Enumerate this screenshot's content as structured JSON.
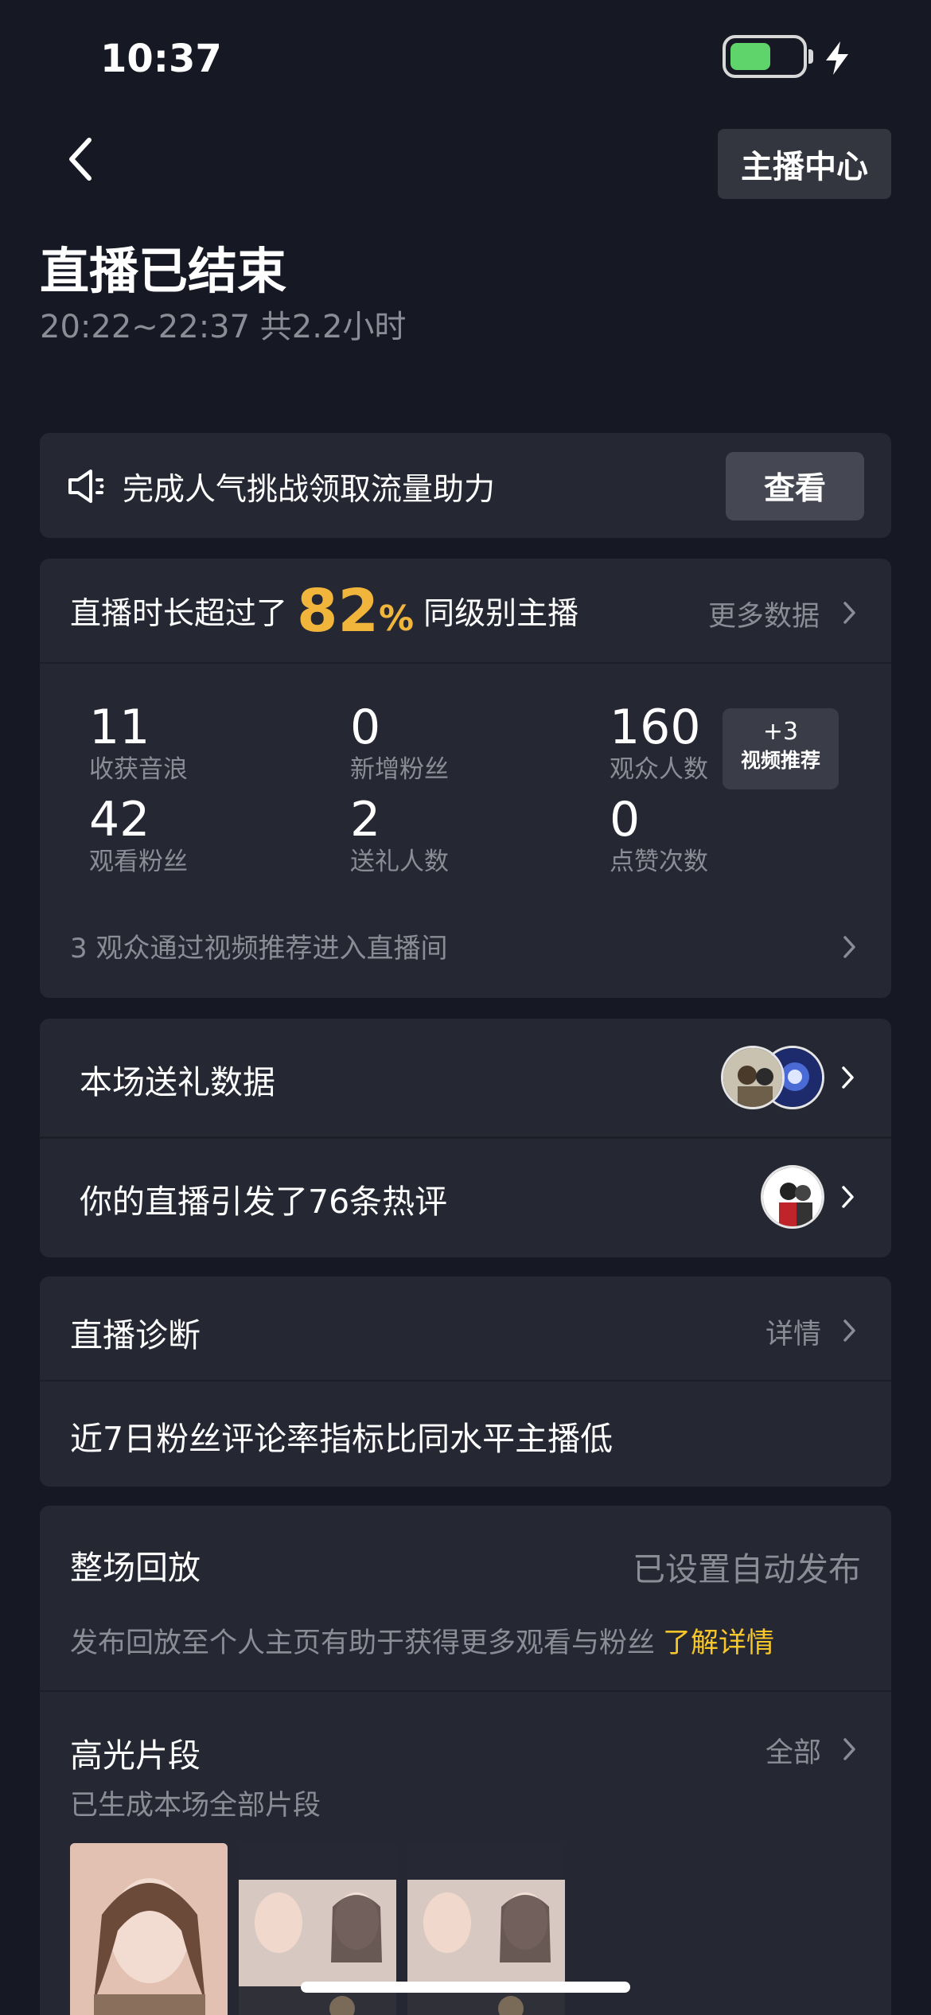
{
  "status_bar": {
    "time": "10:37",
    "battery_level": 0.58,
    "charging": true
  },
  "header": {
    "anchor_center_label": "主播中心",
    "title": "直播已结束",
    "subtitle": "20:22~22:37 共2.2小时"
  },
  "challenge": {
    "text": "完成人气挑战领取流量助力",
    "button_label": "查看"
  },
  "stats": {
    "headline_prefix": "直播时长超过了",
    "percent": "82",
    "percent_sign": "%",
    "headline_suffix": "同级别主播",
    "more_data_label": "更多数据",
    "metrics": [
      {
        "value": "11",
        "label": "收获音浪"
      },
      {
        "value": "0",
        "label": "新增粉丝"
      },
      {
        "value": "160",
        "label": "观众人数"
      },
      {
        "value": "42",
        "label": "观看粉丝"
      },
      {
        "value": "2",
        "label": "送礼人数"
      },
      {
        "value": "0",
        "label": "点赞次数"
      }
    ],
    "video_badge": {
      "count": "+3",
      "label": "视频推荐"
    },
    "via_video_text": "3 观众通过视频推荐进入直播间"
  },
  "gifts": {
    "gift_data_label": "本场送礼数据",
    "hot_comments_label": "你的直播引发了76条热评"
  },
  "diagnosis": {
    "title": "直播诊断",
    "detail_label": "详情",
    "insight": "近7日粉丝评论率指标比同水平主播低"
  },
  "replay": {
    "title": "整场回放",
    "status": "已设置自动发布",
    "description": "发布回放至个人主页有助于获得更多观看与粉丝",
    "learn_more": "了解详情",
    "highlights_title": "高光片段",
    "highlights_all": "全部",
    "highlights_sub": "已生成本场全部片段"
  },
  "colors": {
    "background": "#161824",
    "card": "#252733",
    "accent_gold": "#f1b53b",
    "link_yellow": "#f7c62b",
    "muted_text": "#8b8d96"
  },
  "icons": [
    "chevron-left-icon",
    "speaker-icon",
    "chevron-right-icon",
    "lightning-bolt-icon",
    "battery-icon"
  ]
}
